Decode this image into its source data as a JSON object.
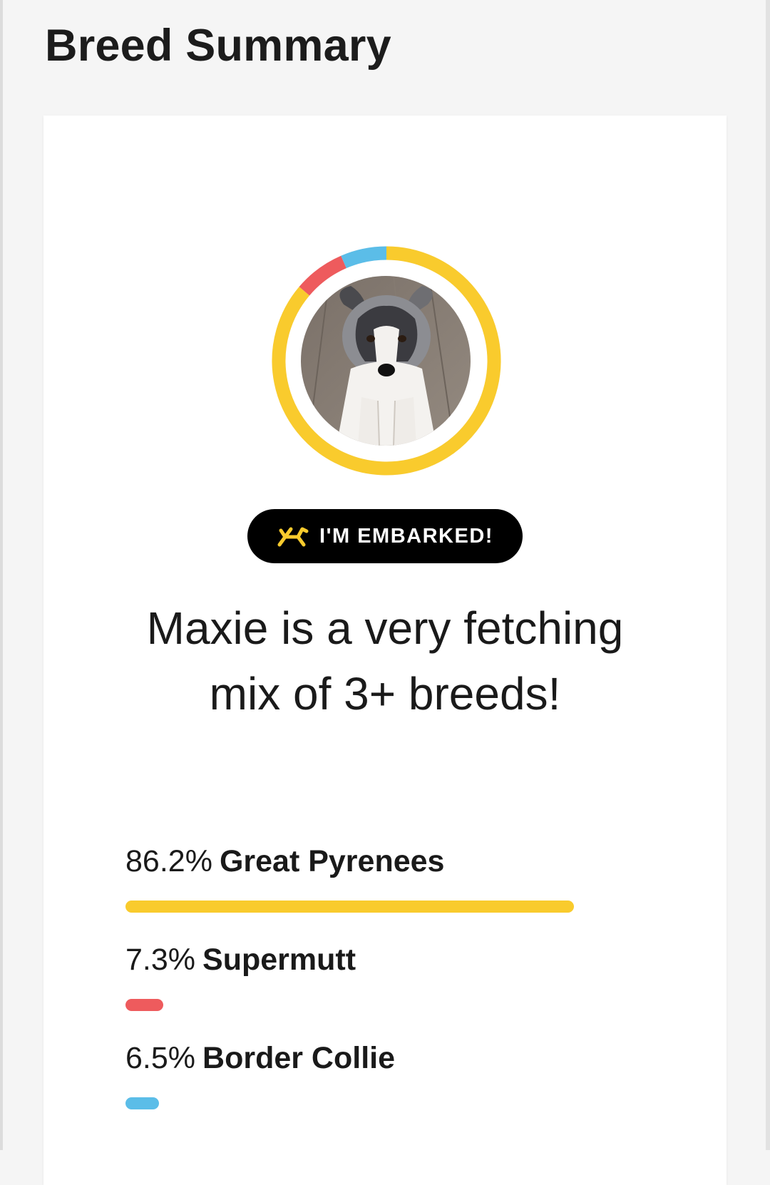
{
  "page": {
    "title": "Breed Summary"
  },
  "colors": {
    "great_pyrenees": "#f9cb2d",
    "supermutt": "#ee5b5d",
    "border_collie": "#5bbde8"
  },
  "profile": {
    "photo": "dog-photo",
    "badge_icon": "balloon-dog-icon",
    "badge_text": "I'M EMBARKED!",
    "headline": "Maxie is a very fetching mix of 3+ breeds!"
  },
  "breeds": [
    {
      "percent_label": "86.2%",
      "name": "Great Pyrenees",
      "value": 86.2,
      "color": "#f9cb2d"
    },
    {
      "percent_label": "7.3%",
      "name": "Supermutt",
      "value": 7.3,
      "color": "#ee5b5d"
    },
    {
      "percent_label": "6.5%",
      "name": "Border Collie",
      "value": 6.5,
      "color": "#5bbde8"
    }
  ]
}
